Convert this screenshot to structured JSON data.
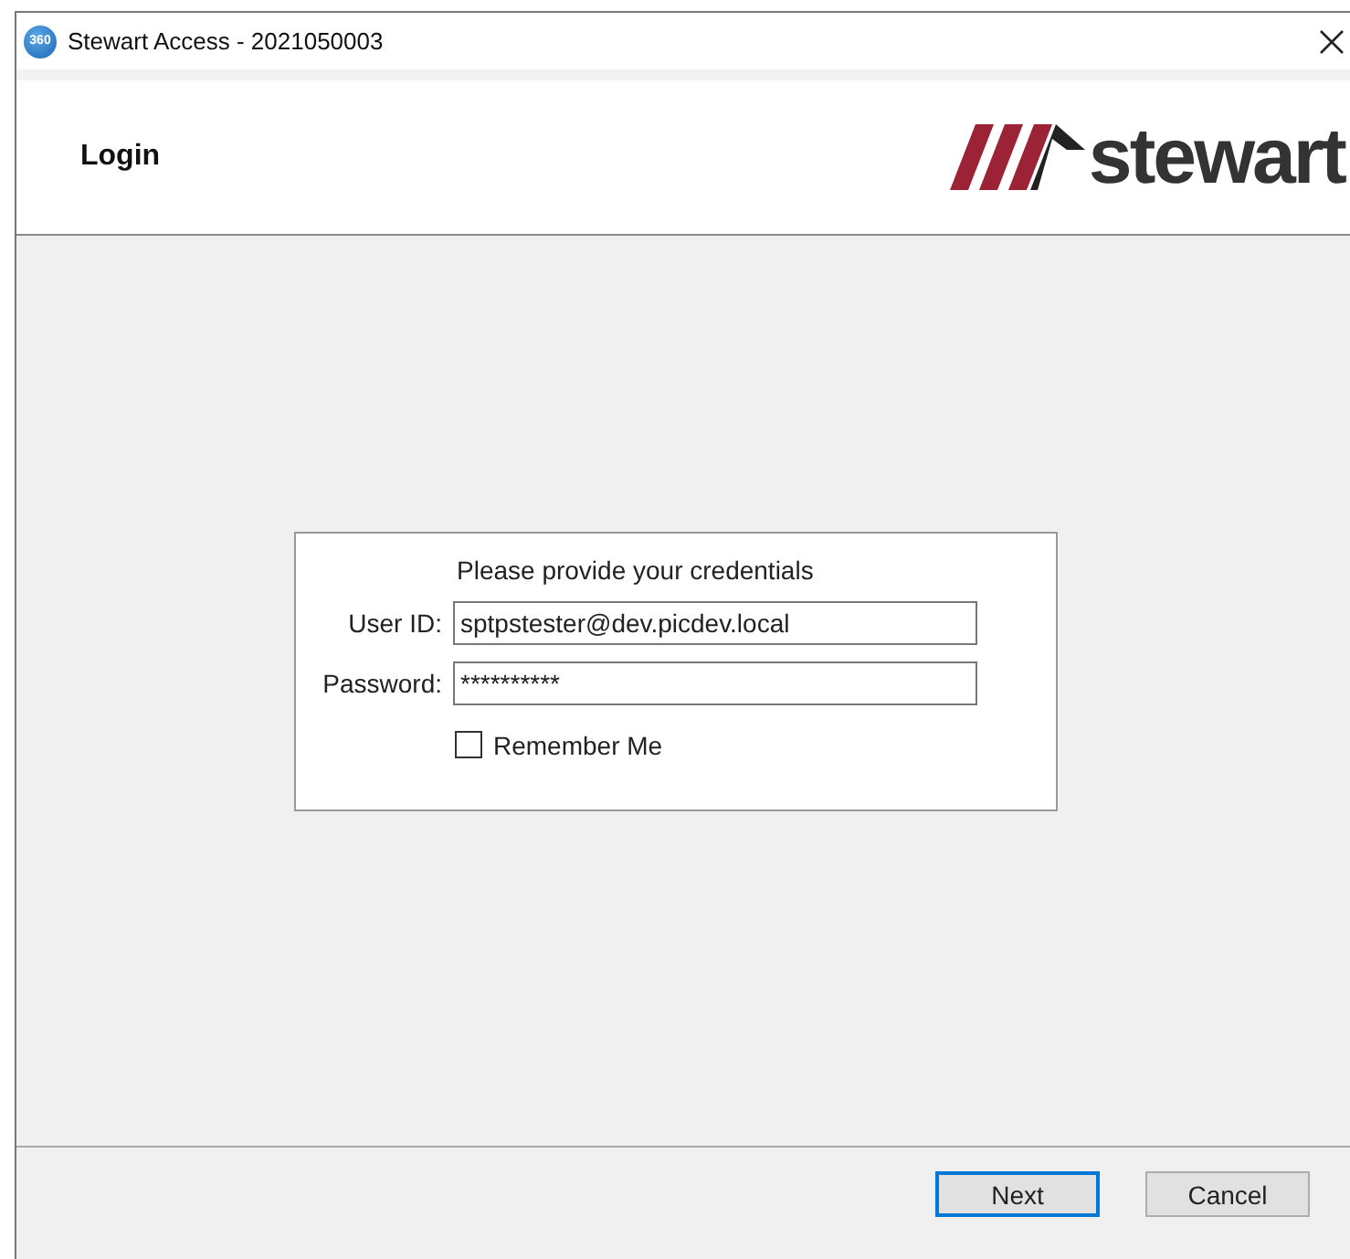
{
  "window": {
    "title": "Stewart Access - 2021050003",
    "app_icon_text": "360"
  },
  "header": {
    "title": "Login",
    "logo_text": "stewart"
  },
  "login": {
    "prompt": "Please provide your credentials",
    "fields": [
      {
        "label": "User ID:",
        "value": "sptpstester@dev.picdev.local"
      },
      {
        "label": "Password:",
        "value": "**********"
      }
    ],
    "remember": {
      "label": "Remember Me",
      "checked": false
    }
  },
  "buttons": [
    {
      "label": "Next",
      "focused": true
    },
    {
      "label": "Cancel",
      "focused": false
    }
  ]
}
